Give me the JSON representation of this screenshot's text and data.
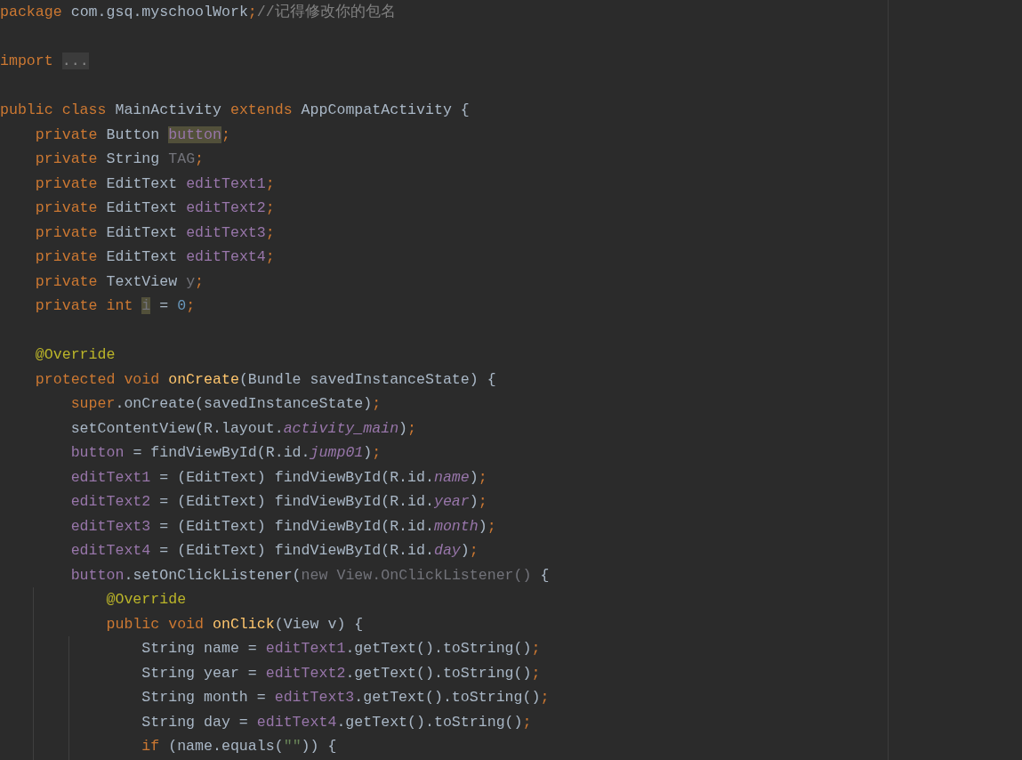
{
  "editor": {
    "lines": [
      {
        "kind": "code",
        "tokens": [
          {
            "kind": "keyword",
            "text": "package"
          },
          {
            "kind": "plain",
            "text": " com.gsq.myschoolWork"
          },
          {
            "kind": "keyword",
            "text": ";"
          },
          {
            "kind": "comment",
            "text": "//记得修改你的包名"
          }
        ]
      },
      {
        "kind": "blank"
      },
      {
        "kind": "code",
        "tokens": [
          {
            "kind": "keyword",
            "text": "import "
          },
          {
            "kind": "fold",
            "text": "..."
          }
        ]
      },
      {
        "kind": "blank"
      },
      {
        "kind": "code",
        "tokens": [
          {
            "kind": "keyword",
            "text": "public class"
          },
          {
            "kind": "plain",
            "text": " MainActivity "
          },
          {
            "kind": "keyword",
            "text": "extends"
          },
          {
            "kind": "plain",
            "text": " AppCompatActivity {"
          }
        ]
      },
      {
        "kind": "code",
        "tokens": [
          {
            "kind": "keyword",
            "text": "    private"
          },
          {
            "kind": "plain",
            "text": " Button "
          },
          {
            "kind": "field-highlight",
            "text": "button"
          },
          {
            "kind": "keyword",
            "text": ";"
          }
        ]
      },
      {
        "kind": "code",
        "tokens": [
          {
            "kind": "keyword",
            "text": "    private"
          },
          {
            "kind": "plain",
            "text": " String "
          },
          {
            "kind": "muted",
            "text": "TAG"
          },
          {
            "kind": "keyword",
            "text": ";"
          }
        ]
      },
      {
        "kind": "code",
        "tokens": [
          {
            "kind": "keyword",
            "text": "    private"
          },
          {
            "kind": "plain",
            "text": " EditText "
          },
          {
            "kind": "field",
            "text": "editText1"
          },
          {
            "kind": "keyword",
            "text": ";"
          }
        ]
      },
      {
        "kind": "code",
        "tokens": [
          {
            "kind": "keyword",
            "text": "    private"
          },
          {
            "kind": "plain",
            "text": " EditText "
          },
          {
            "kind": "field",
            "text": "editText2"
          },
          {
            "kind": "keyword",
            "text": ";"
          }
        ]
      },
      {
        "kind": "code",
        "tokens": [
          {
            "kind": "keyword",
            "text": "    private"
          },
          {
            "kind": "plain",
            "text": " EditText "
          },
          {
            "kind": "field",
            "text": "editText3"
          },
          {
            "kind": "keyword",
            "text": ";"
          }
        ]
      },
      {
        "kind": "code",
        "tokens": [
          {
            "kind": "keyword",
            "text": "    private"
          },
          {
            "kind": "plain",
            "text": " EditText "
          },
          {
            "kind": "field",
            "text": "editText4"
          },
          {
            "kind": "keyword",
            "text": ";"
          }
        ]
      },
      {
        "kind": "code",
        "tokens": [
          {
            "kind": "keyword",
            "text": "    private"
          },
          {
            "kind": "plain",
            "text": " TextView "
          },
          {
            "kind": "muted",
            "text": "y"
          },
          {
            "kind": "keyword",
            "text": ";"
          }
        ]
      },
      {
        "kind": "code",
        "tokens": [
          {
            "kind": "keyword",
            "text": "    private int "
          },
          {
            "kind": "muted-highlight",
            "text": "i"
          },
          {
            "kind": "plain",
            "text": " = "
          },
          {
            "kind": "number",
            "text": "0"
          },
          {
            "kind": "keyword",
            "text": ";"
          }
        ]
      },
      {
        "kind": "blank"
      },
      {
        "kind": "code",
        "tokens": [
          {
            "kind": "annotation",
            "text": "    @Override"
          }
        ]
      },
      {
        "kind": "code",
        "tokens": [
          {
            "kind": "keyword",
            "text": "    protected void "
          },
          {
            "kind": "method",
            "text": "onCreate"
          },
          {
            "kind": "plain",
            "text": "(Bundle savedInstanceState) {"
          }
        ]
      },
      {
        "kind": "code",
        "tokens": [
          {
            "kind": "keyword",
            "text": "        super"
          },
          {
            "kind": "plain",
            "text": ".onCreate(savedInstanceState)"
          },
          {
            "kind": "keyword",
            "text": ";"
          }
        ]
      },
      {
        "kind": "code",
        "tokens": [
          {
            "kind": "plain",
            "text": "        setContentView(R.layout."
          },
          {
            "kind": "static",
            "text": "activity_main"
          },
          {
            "kind": "plain",
            "text": ")"
          },
          {
            "kind": "keyword",
            "text": ";"
          }
        ]
      },
      {
        "kind": "code",
        "tokens": [
          {
            "kind": "field",
            "text": "        button"
          },
          {
            "kind": "plain",
            "text": " = findViewById(R.id."
          },
          {
            "kind": "static",
            "text": "jump01"
          },
          {
            "kind": "plain",
            "text": ")"
          },
          {
            "kind": "keyword",
            "text": ";"
          }
        ]
      },
      {
        "kind": "code",
        "tokens": [
          {
            "kind": "field",
            "text": "        editText1"
          },
          {
            "kind": "plain",
            "text": " = (EditText) findViewById(R.id."
          },
          {
            "kind": "static",
            "text": "name"
          },
          {
            "kind": "plain",
            "text": ")"
          },
          {
            "kind": "keyword",
            "text": ";"
          }
        ]
      },
      {
        "kind": "code",
        "tokens": [
          {
            "kind": "field",
            "text": "        editText2"
          },
          {
            "kind": "plain",
            "text": " = (EditText) findViewById(R.id."
          },
          {
            "kind": "static",
            "text": "year"
          },
          {
            "kind": "plain",
            "text": ")"
          },
          {
            "kind": "keyword",
            "text": ";"
          }
        ]
      },
      {
        "kind": "code",
        "tokens": [
          {
            "kind": "field",
            "text": "        editText3"
          },
          {
            "kind": "plain",
            "text": " = (EditText) findViewById(R.id."
          },
          {
            "kind": "static",
            "text": "month"
          },
          {
            "kind": "plain",
            "text": ")"
          },
          {
            "kind": "keyword",
            "text": ";"
          }
        ]
      },
      {
        "kind": "code",
        "tokens": [
          {
            "kind": "field",
            "text": "        editText4"
          },
          {
            "kind": "plain",
            "text": " = (EditText) findViewById(R.id."
          },
          {
            "kind": "static",
            "text": "day"
          },
          {
            "kind": "plain",
            "text": ")"
          },
          {
            "kind": "keyword",
            "text": ";"
          }
        ]
      },
      {
        "kind": "code",
        "tokens": [
          {
            "kind": "field",
            "text": "        button"
          },
          {
            "kind": "plain",
            "text": ".setOnClickListener("
          },
          {
            "kind": "muted",
            "text": "new View.OnClickListener()"
          },
          {
            "kind": "plain",
            "text": " {"
          }
        ]
      },
      {
        "kind": "code",
        "tokens": [
          {
            "kind": "annotation",
            "text": "            @Override"
          }
        ]
      },
      {
        "kind": "code",
        "tokens": [
          {
            "kind": "keyword",
            "text": "            public void "
          },
          {
            "kind": "method",
            "text": "onClick"
          },
          {
            "kind": "plain",
            "text": "(View v) {"
          }
        ]
      },
      {
        "kind": "code",
        "tokens": [
          {
            "kind": "plain",
            "text": "                String name = "
          },
          {
            "kind": "field",
            "text": "editText1"
          },
          {
            "kind": "plain",
            "text": ".getText().toString()"
          },
          {
            "kind": "keyword",
            "text": ";"
          }
        ]
      },
      {
        "kind": "code",
        "tokens": [
          {
            "kind": "plain",
            "text": "                String year = "
          },
          {
            "kind": "field",
            "text": "editText2"
          },
          {
            "kind": "plain",
            "text": ".getText().toString()"
          },
          {
            "kind": "keyword",
            "text": ";"
          }
        ]
      },
      {
        "kind": "code",
        "tokens": [
          {
            "kind": "plain",
            "text": "                String month = "
          },
          {
            "kind": "field",
            "text": "editText3"
          },
          {
            "kind": "plain",
            "text": ".getText().toString()"
          },
          {
            "kind": "keyword",
            "text": ";"
          }
        ]
      },
      {
        "kind": "code",
        "tokens": [
          {
            "kind": "plain",
            "text": "                String day = "
          },
          {
            "kind": "field",
            "text": "editText4"
          },
          {
            "kind": "plain",
            "text": ".getText().toString()"
          },
          {
            "kind": "keyword",
            "text": ";"
          }
        ]
      },
      {
        "kind": "code",
        "tokens": [
          {
            "kind": "keyword",
            "text": "                if"
          },
          {
            "kind": "plain",
            "text": " (name.equals("
          },
          {
            "kind": "string",
            "text": "\"\""
          },
          {
            "kind": "plain",
            "text": ")) {"
          }
        ]
      }
    ]
  }
}
